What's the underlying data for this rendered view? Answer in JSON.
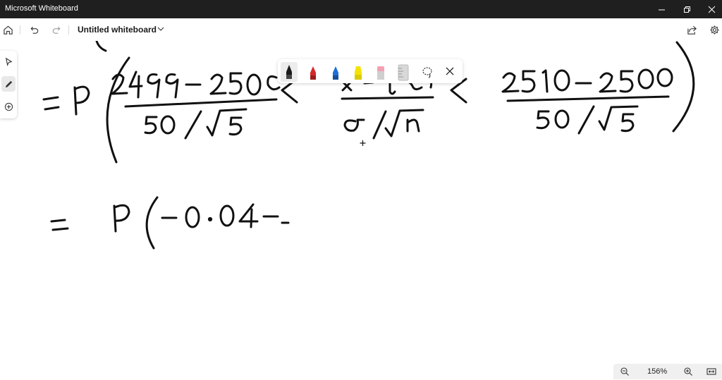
{
  "window": {
    "title": "Microsoft Whiteboard"
  },
  "toolbar": {
    "board_name": "Untitled whiteboard"
  },
  "zoom": {
    "level": "156%"
  },
  "pen_colors": {
    "black": "#1a1a1a",
    "red": "#d42a2a",
    "blue": "#1f6fd6",
    "yellow": "#f4e300",
    "pink": "#f4a0b4"
  },
  "icons": [
    "home-icon",
    "undo-icon",
    "redo-icon",
    "share-icon",
    "settings-icon",
    "select-icon",
    "pen-icon",
    "add-icon",
    "lasso-icon",
    "close-icon",
    "zoom-out-icon",
    "zoom-in-icon",
    "fit-icon"
  ]
}
